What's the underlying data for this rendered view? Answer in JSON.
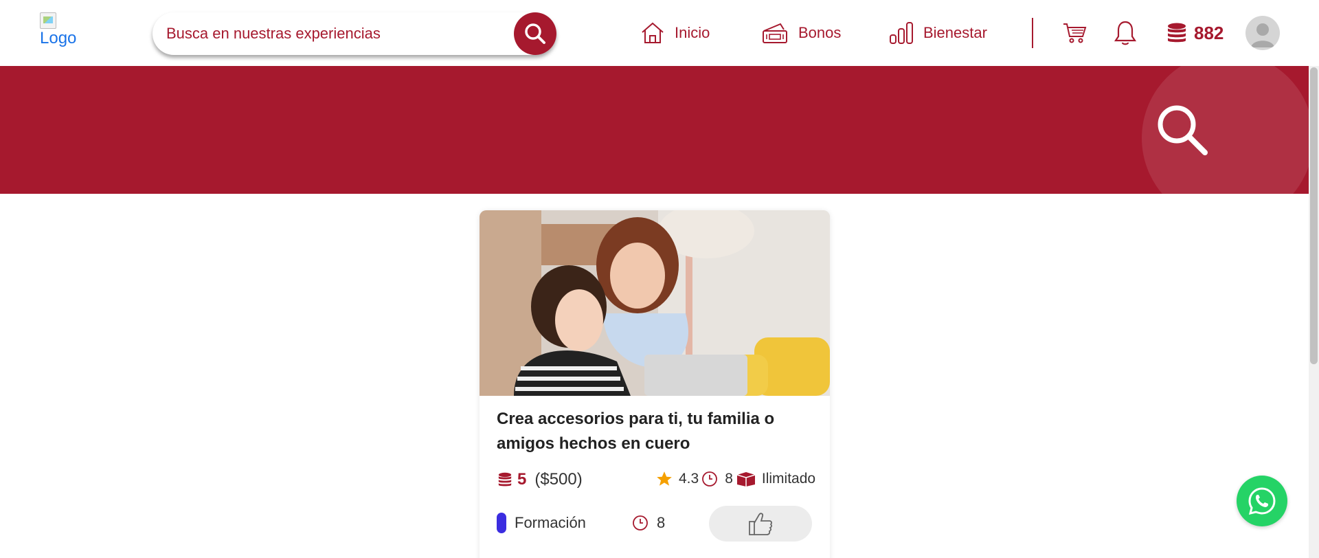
{
  "header": {
    "logo_alt": "Logo",
    "search_placeholder": "Busca en nuestras experiencias",
    "nav": [
      {
        "label": "Inicio",
        "icon": "home-icon"
      },
      {
        "label": "Bonos",
        "icon": "voucher-icon"
      },
      {
        "label": "Bienestar",
        "icon": "bar-chart-icon"
      }
    ],
    "coins_balance": "882"
  },
  "card": {
    "title": "Crea accesorios para ti, tu familia o amigos hechos en cuero",
    "coin_price": "5",
    "money_price": "($500)",
    "rating": "4.3",
    "duration": "8",
    "availability": "Ilimitado",
    "category": "Formación",
    "hours": "8"
  },
  "colors": {
    "brand": "#a6192e",
    "category_tag": "#3b2de0",
    "rating_star": "#f5a000",
    "whatsapp": "#25d366"
  }
}
